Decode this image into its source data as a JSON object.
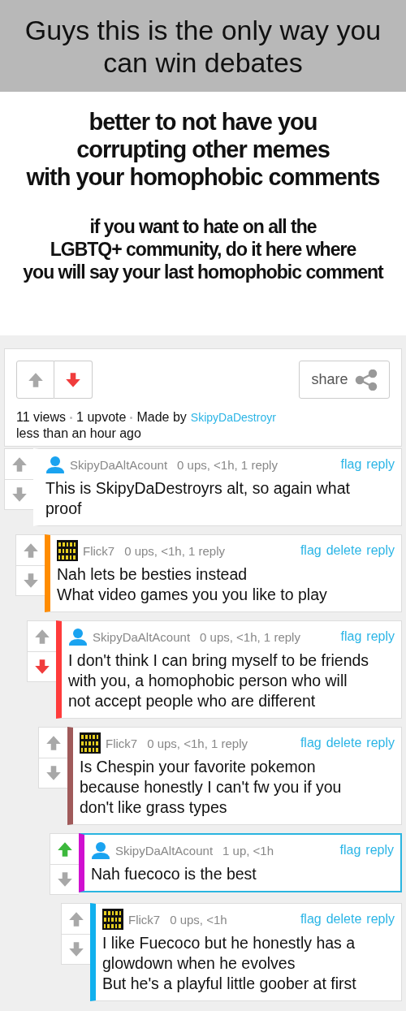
{
  "caption": "Guys this is the only way you can win debates",
  "meme_text": [
    [
      "better to not have you",
      "corrupting other memes",
      "with your homophobic comments"
    ],
    [
      "if you want to hate on all the",
      "LGBTQ+ community, do it here where",
      "you will say your last homophobic comment"
    ]
  ],
  "post": {
    "upvoted": false,
    "downvoted": true,
    "share": "share",
    "views": "11 views",
    "upvotes": "1 upvote",
    "made_by": "Made by",
    "author": "SkipyDaDestroyr",
    "time": "less than an hour ago"
  },
  "comments": [
    {
      "kind": "person",
      "user": "SkipyDaAltAcount",
      "meta": "0 ups, <1h, 1 reply",
      "actions": [
        "flag",
        "reply"
      ],
      "text": "This is SkipyDaDestroyrs alt, so again what\nproof",
      "upvoted": false,
      "downvoted": false,
      "color": "#ffffff",
      "highlighted": false,
      "children": [
        {
          "kind": "binary",
          "user": "Flick7",
          "meta": "0 ups, <1h, 1 reply",
          "actions": [
            "flag",
            "delete",
            "reply"
          ],
          "text": "Nah lets be besties instead\nWhat video games you you like to play",
          "upvoted": false,
          "downvoted": false,
          "color": "#ff8c00",
          "highlighted": false,
          "children": [
            {
              "kind": "person",
              "user": "SkipyDaAltAcount",
              "meta": "0 ups, <1h, 1 reply",
              "actions": [
                "flag",
                "reply"
              ],
              "text": "I don't think I can bring myself to be friends\nwith you, a homophobic person who will\nnot accept people who are different",
              "upvoted": false,
              "downvoted": true,
              "color": "#ff3b3b",
              "highlighted": false,
              "children": [
                {
                  "kind": "binary",
                  "user": "Flick7",
                  "meta": "0 ups, <1h, 1 reply",
                  "actions": [
                    "flag",
                    "delete",
                    "reply"
                  ],
                  "text": "Is Chespin your favorite pokemon\nbecause honestly I can't fw you if you\ndon't like grass types",
                  "upvoted": false,
                  "downvoted": false,
                  "color": "#a05a5a",
                  "highlighted": false,
                  "children": [
                    {
                      "kind": "person",
                      "user": "SkipyDaAltAcount",
                      "meta": "1 up, <1h",
                      "actions": [
                        "flag",
                        "reply"
                      ],
                      "text": "Nah fuecoco is the best",
                      "upvoted": true,
                      "downvoted": false,
                      "color": "#d010d0",
                      "highlighted": true,
                      "children": [
                        {
                          "kind": "binary",
                          "user": "Flick7",
                          "meta": "0 ups, <1h",
                          "actions": [
                            "flag",
                            "delete",
                            "reply"
                          ],
                          "text": "I like Fuecoco but he honestly has a\nglowdown when he evolves\nBut he's a playful little goober at first",
                          "upvoted": false,
                          "downvoted": false,
                          "color": "#10b0ee",
                          "highlighted": false
                        }
                      ]
                    }
                  ]
                }
              ]
            }
          ]
        }
      ]
    }
  ]
}
